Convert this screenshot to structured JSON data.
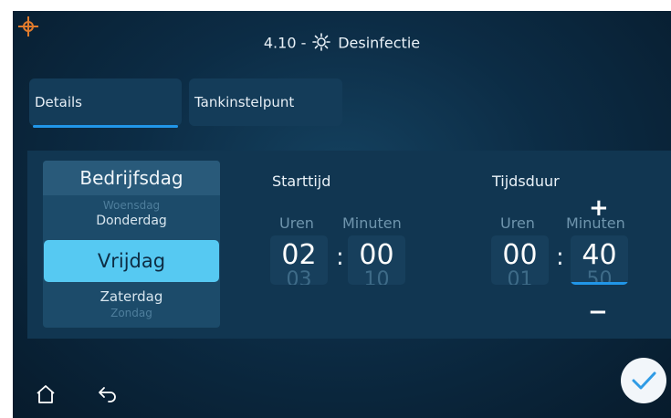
{
  "header": {
    "title_prefix": "4.10 -",
    "title_icon": "sun-gear-icon",
    "title_text": "Desinfectie",
    "accent_color": "#e07b2c"
  },
  "tabs": [
    {
      "label": "Details",
      "active": true
    },
    {
      "label": "Tankinstelpunt",
      "active": false
    }
  ],
  "day_picker": {
    "header": "Bedrijfsdag",
    "prev2": "Woensdag",
    "prev1": "Donderdag",
    "selected": "Vrijdag",
    "next1": "Zaterdag",
    "next2": "Zondag",
    "selected_color": "#56c9f2"
  },
  "start_time": {
    "label": "Starttijd",
    "hours_label": "Uren",
    "minutes_label": "Minuten",
    "hours": "02",
    "hours_next": "03",
    "minutes": "00",
    "minutes_next": "10",
    "separator": ":"
  },
  "duration": {
    "label": "Tijdsduur",
    "hours_label": "Uren",
    "minutes_label": "Minuten",
    "hours": "00",
    "hours_next": "01",
    "minutes": "40",
    "minutes_next": "50",
    "separator": ":",
    "increment": "+",
    "decrement": "−"
  },
  "footer": {
    "home_icon": "home-icon",
    "back_icon": "back-arrow-icon",
    "confirm_icon": "checkmark-icon",
    "confirm_color": "#2f9be5"
  }
}
